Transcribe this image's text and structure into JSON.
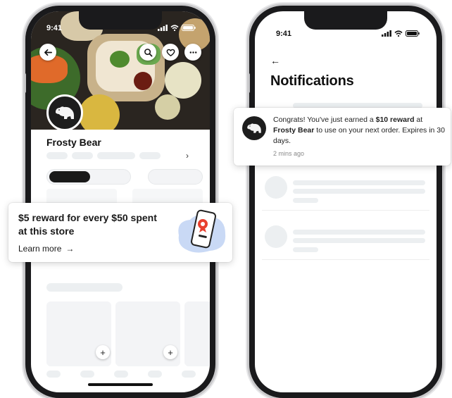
{
  "left_phone": {
    "status_time": "9:41",
    "store_name": "Frosty Bear"
  },
  "right_phone": {
    "status_time": "9:41",
    "title": "Notifications"
  },
  "reward_card": {
    "headline": "$5 reward for every $50 spent at this store",
    "link_label": "Learn more",
    "link_arrow": "→"
  },
  "notification": {
    "text_before": "Congrats! You've just earned a ",
    "reward_amount": "$10 reward",
    "text_middle": " at ",
    "store_name": "Frosty Bear",
    "text_after": " to use on your next order. Expires in 30 days.",
    "time_ago": "2 mins ago"
  },
  "icons": [
    "back-arrow-icon",
    "search-icon",
    "heart-icon",
    "more-icon",
    "chevron-right-icon",
    "plus-icon",
    "polar-bear-logo",
    "phone-reward-illustration",
    "signal-icon",
    "wifi-icon",
    "battery-icon"
  ],
  "colors": {
    "card_bg": "#ffffff",
    "skeleton": "#eceff1",
    "text_primary": "#191919",
    "reward_badge": "#e8402f",
    "illus_blob": "#c9d9f5"
  }
}
